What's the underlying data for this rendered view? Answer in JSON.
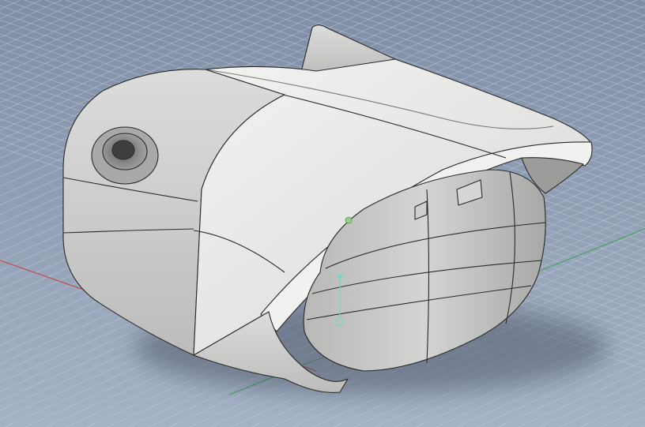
{
  "viewport": {
    "background_top": "#7f8ea6",
    "background_bottom": "#a6b3c5",
    "grid_color": "#c2ccda",
    "x_axis_color": "#d03a3a",
    "y_axis_color": "#3aa650"
  },
  "model": {
    "body_fill": "#e9e9e7",
    "shade_fill": "#bdbdbb",
    "dark_fill": "#8b8b89",
    "edge_color": "#2a2a2a",
    "icons": [
      "mounting-hole",
      "origin-point",
      "sketch-pivot-marker"
    ]
  }
}
